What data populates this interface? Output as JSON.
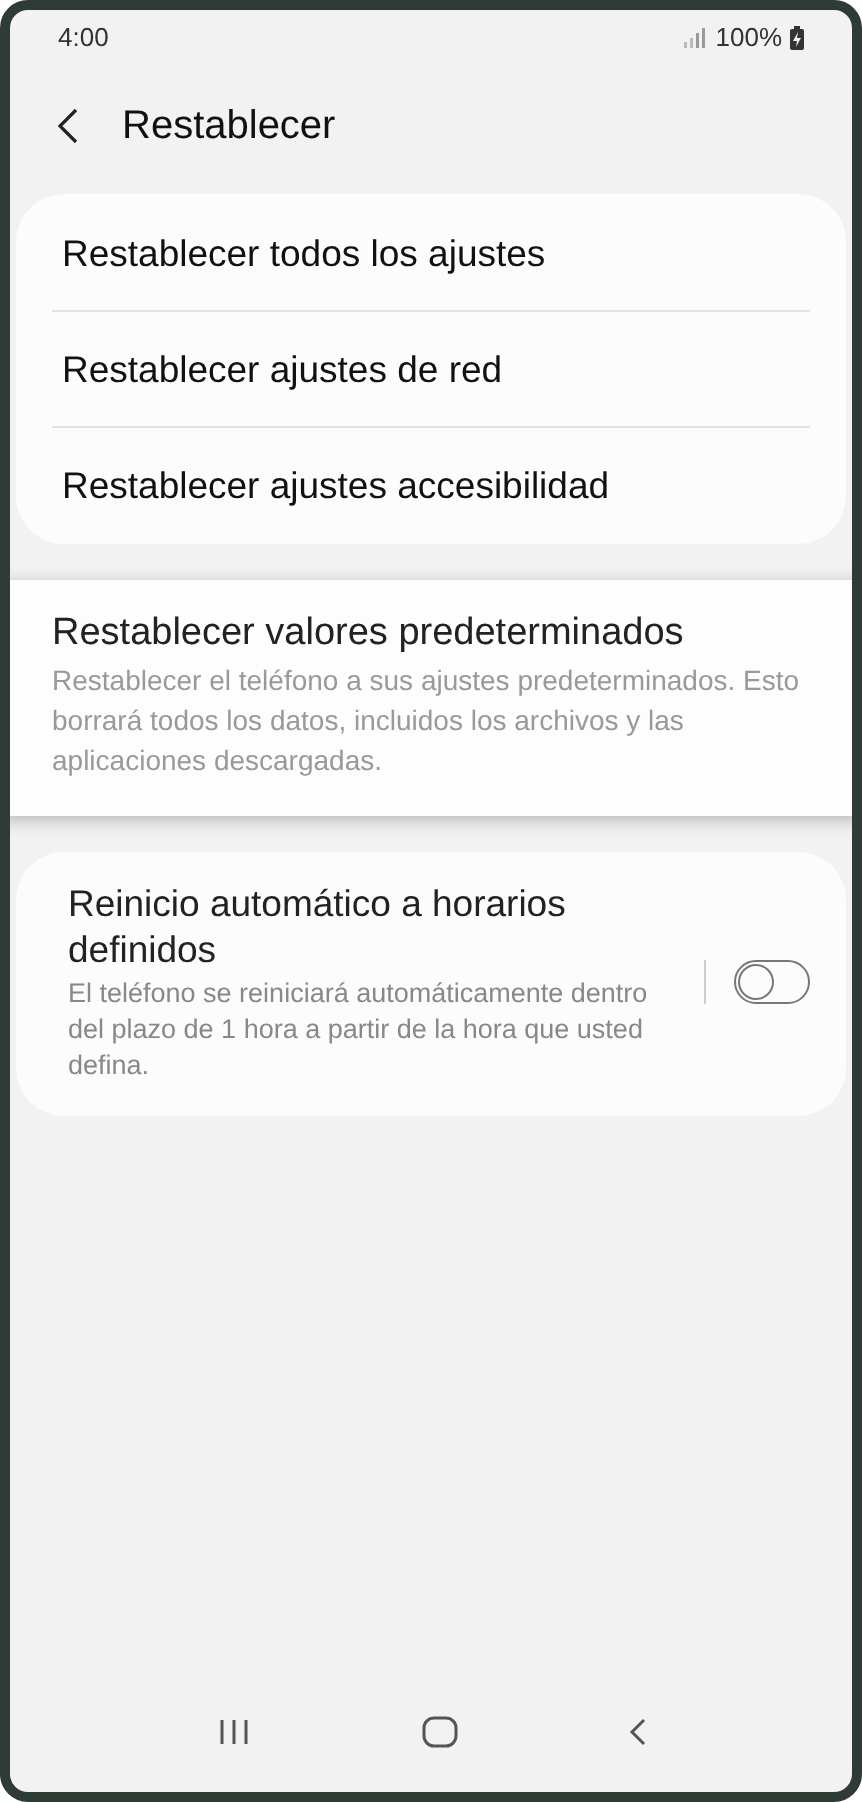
{
  "status_bar": {
    "time": "4:00",
    "battery": "100%"
  },
  "header": {
    "title": "Restablecer"
  },
  "reset_options": [
    {
      "label": "Restablecer todos los ajustes"
    },
    {
      "label": "Restablecer ajustes de red"
    },
    {
      "label": "Restablecer ajustes accesibilidad"
    }
  ],
  "factory_reset": {
    "title": "Restablecer valores predeterminados",
    "description": "Restablecer el teléfono a sus ajustes predeterminados. Esto borrará todos los datos, incluidos los archivos y las aplicaciones descargadas."
  },
  "auto_restart": {
    "title": "Reinicio automático a horarios definidos",
    "description": "El teléfono se reiniciará automáticamente dentro del plazo de 1 hora a partir de la hora que usted defina.",
    "on": false
  }
}
